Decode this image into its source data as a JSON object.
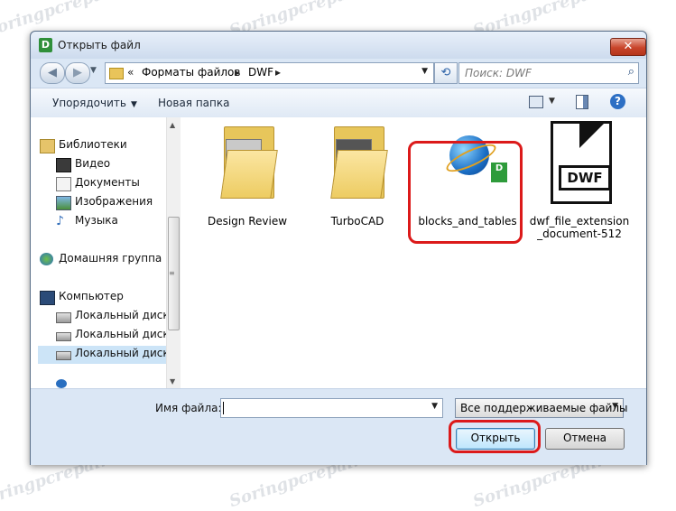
{
  "window": {
    "title": "Открыть файл",
    "app_icon_letter": "D",
    "close_glyph": "✕"
  },
  "nav": {
    "back_glyph": "◀",
    "forward_glyph": "▶",
    "address": {
      "chevron": "«",
      "crumbs": [
        "Форматы файлов",
        "DWF"
      ],
      "sep": "▸"
    },
    "search_placeholder": "Поиск: DWF"
  },
  "toolbar": {
    "organize_label": "Упорядочить",
    "new_folder_label": "Новая папка",
    "help_glyph": "?"
  },
  "sidebar": {
    "items": [
      {
        "label": "Библиотеки",
        "icon": "libraries-icon"
      },
      {
        "label": "Видео",
        "icon": "video-icon"
      },
      {
        "label": "Документы",
        "icon": "documents-icon"
      },
      {
        "label": "Изображения",
        "icon": "pictures-icon"
      },
      {
        "label": "Музыка",
        "icon": "music-icon"
      },
      {
        "label": "Домашняя группа",
        "icon": "homegroup-icon"
      },
      {
        "label": "Компьютер",
        "icon": "computer-icon"
      },
      {
        "label": "Локальный диск",
        "icon": "drive-icon"
      },
      {
        "label": "Локальный диск",
        "icon": "drive-icon"
      },
      {
        "label": "Локальный диск",
        "icon": "drive-icon"
      }
    ],
    "selected_index": 9
  },
  "files": [
    {
      "name": "Design Review",
      "type": "folder"
    },
    {
      "name": "TurboCAD",
      "type": "folder"
    },
    {
      "name": "blocks_and_tables",
      "type": "dwf-file",
      "badge": "D"
    },
    {
      "name": "dwf_file_extension_document-512",
      "type": "image",
      "box_text": "DWF"
    }
  ],
  "bottom": {
    "filename_label": "Имя файла:",
    "filename_value": "",
    "filter_value": "Все поддерживаемые файлы",
    "open_label": "Открыть",
    "cancel_label": "Отмена"
  },
  "watermark": "Soringpcrepair.com",
  "colors": {
    "highlight": "#dc1a1a",
    "window_bg": "#dbe7f5",
    "selected_row": "#cce4f7"
  }
}
